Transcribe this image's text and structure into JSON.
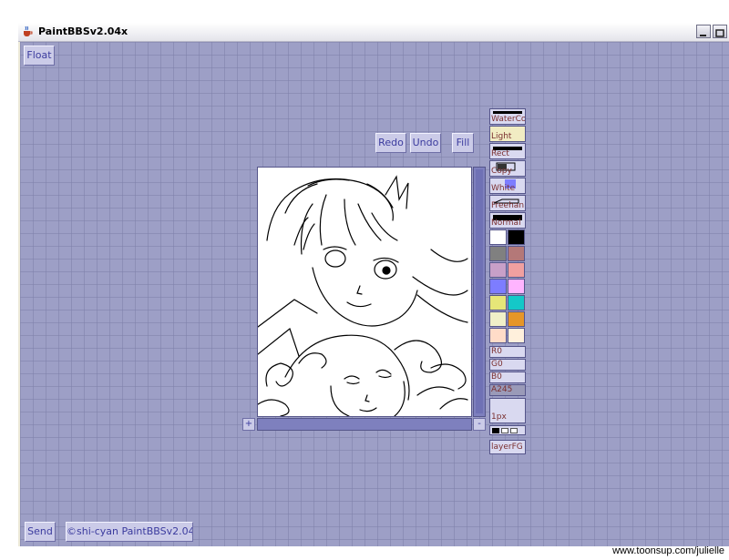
{
  "window": {
    "title": "PaintBBSv2.04x"
  },
  "buttons": {
    "float": "Float",
    "redo": "Redo",
    "undo": "Undo",
    "fill": "Fill",
    "send": "Send",
    "copyright": "©shi-cyan PaintBBSv2.04x"
  },
  "scroll": {
    "zoom_in": "+",
    "zoom_out": "-"
  },
  "tools": [
    {
      "label": "WaterCo"
    },
    {
      "label": "Light"
    },
    {
      "label": "Rect"
    },
    {
      "label": "Copy"
    },
    {
      "label": "White"
    },
    {
      "label": "Freehan"
    },
    {
      "label": "Normal"
    }
  ],
  "palette": [
    "#ffffff",
    "#000000",
    "#808080",
    "#b47878",
    "#c8a0c8",
    "#f0a0a0",
    "#7d7dff",
    "#ffb4ff",
    "#e6e678",
    "#14c8c8",
    "#f0f0c8",
    "#e69628",
    "#ffdcc8",
    "#fff0dc"
  ],
  "values": {
    "r": "R0",
    "g": "G0",
    "b": "B0",
    "a": "A245",
    "size": "1px",
    "layer": "layerFG"
  },
  "footer": "www.toonsup.com/julielle"
}
